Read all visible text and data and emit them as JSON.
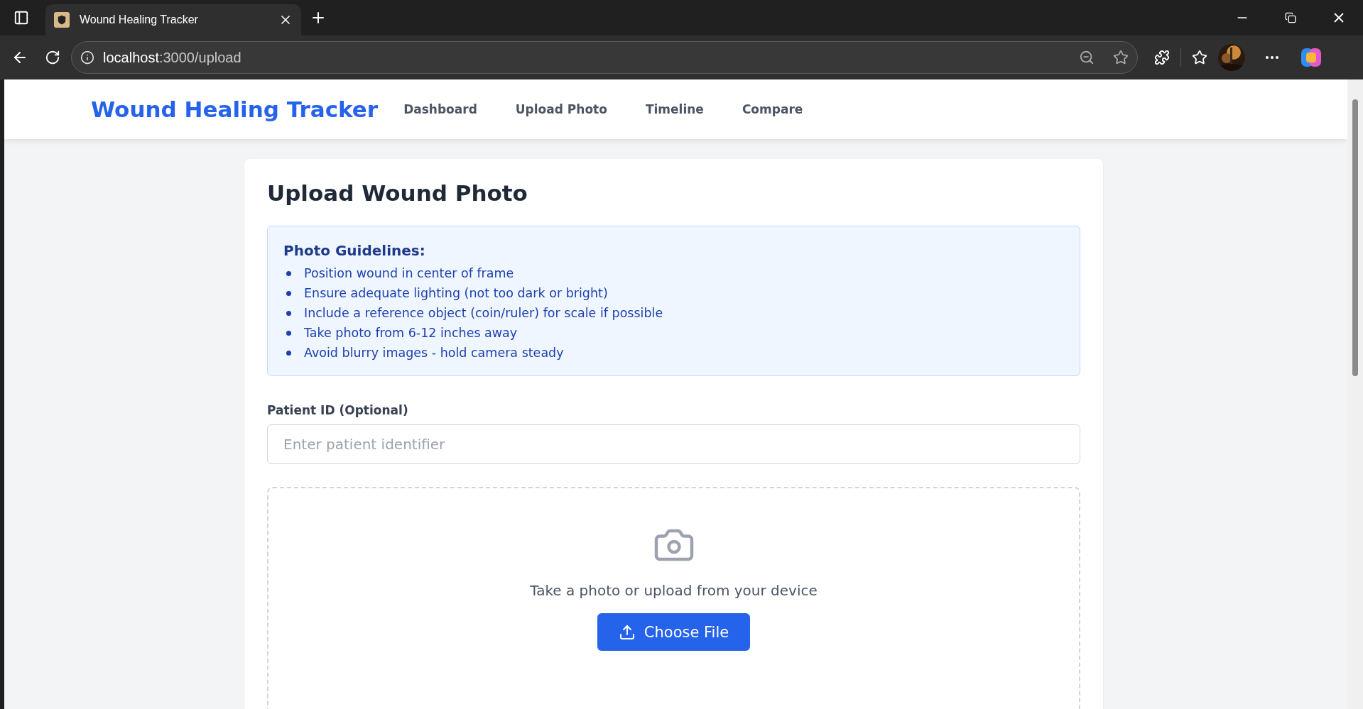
{
  "browser": {
    "tab_title": "Wound Healing Tracker",
    "url_host": "localhost",
    "url_path": ":3000/upload"
  },
  "navbar": {
    "brand": "Wound Healing Tracker",
    "links": [
      "Dashboard",
      "Upload Photo",
      "Timeline",
      "Compare"
    ]
  },
  "page": {
    "title": "Upload Wound Photo",
    "guidelines": {
      "heading": "Photo Guidelines:",
      "items": [
        "Position wound in center of frame",
        "Ensure adequate lighting (not too dark or bright)",
        "Include a reference object (coin/ruler) for scale if possible",
        "Take photo from 6-12 inches away",
        "Avoid blurry images - hold camera steady"
      ]
    },
    "patient_id": {
      "label": "Patient ID (Optional)",
      "placeholder": "Enter patient identifier"
    },
    "dropzone": {
      "text": "Take a photo or upload from your device",
      "button": "Choose File"
    }
  }
}
